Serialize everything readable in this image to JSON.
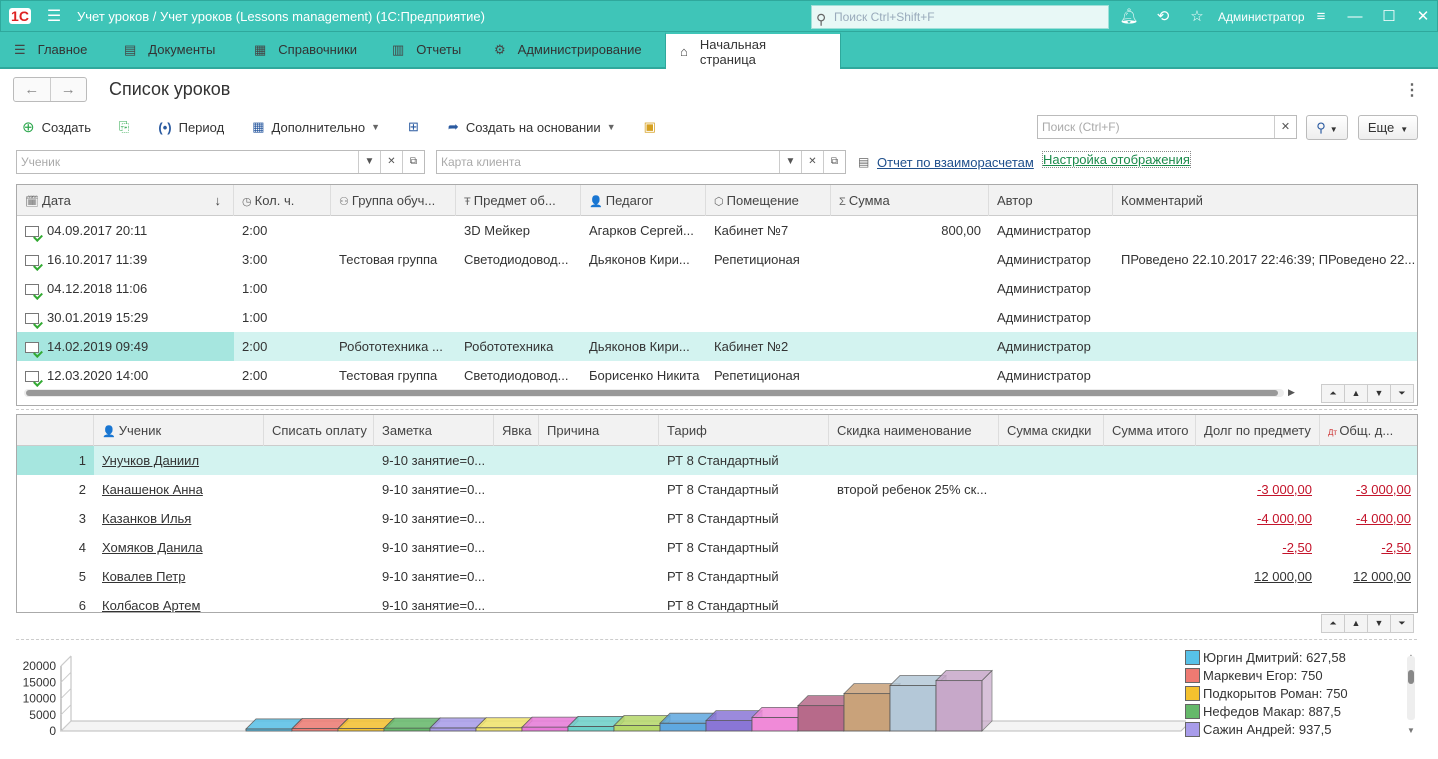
{
  "window": {
    "title": "Учет уроков / Учет уроков (Lessons management)  (1С:Предприятие)",
    "search_placeholder": "Поиск Ctrl+Shift+F",
    "user": "Администратор"
  },
  "sections": [
    {
      "label": "Главное",
      "icon": "menu-icon"
    },
    {
      "label": "Документы",
      "icon": "documents-icon"
    },
    {
      "label": "Справочники",
      "icon": "catalogs-icon"
    },
    {
      "label": "Отчеты",
      "icon": "reports-icon"
    },
    {
      "label": "Администрирование",
      "icon": "admin-gear-icon"
    },
    {
      "label": "Начальная страница",
      "icon": "home-icon"
    }
  ],
  "page": {
    "title": "Список уроков"
  },
  "toolbar": {
    "create": "Создать",
    "period": "Период",
    "additional": "Дополнительно",
    "create_based": "Создать на основании",
    "search_placeholder": "Поиск (Ctrl+F)",
    "more": "Еще"
  },
  "filters": {
    "student_placeholder": "Ученик",
    "client_card_placeholder": "Карта клиента",
    "report_link": "Отчет по взаиморасчетам",
    "display_settings_link": "Настройка отображения"
  },
  "lessons": {
    "columns": [
      "Дата",
      "Кол. ч.",
      "Группа обуч...",
      "Предмет об...",
      "Педагог",
      "Помещение",
      "Сумма",
      "Автор",
      "Комментарий"
    ],
    "rows": [
      [
        "04.09.2017 20:11",
        "2:00",
        "",
        "3D Мейкер",
        "Агарков Сергей...",
        "Кабинет №7",
        "800,00",
        "Администратор",
        ""
      ],
      [
        "16.10.2017 11:39",
        "3:00",
        "Тестовая группа",
        "Светодиодовод...",
        "Дьяконов Кири...",
        "Репетиционая",
        "",
        "Администратор",
        "ПРоведено 22.10.2017 22:46:39; ПРоведено 22..."
      ],
      [
        "04.12.2018 11:06",
        "1:00",
        "",
        "",
        "",
        "",
        "",
        "Администратор",
        ""
      ],
      [
        "30.01.2019 15:29",
        "1:00",
        "",
        "",
        "",
        "",
        "",
        "Администратор",
        ""
      ],
      [
        "14.02.2019 09:49",
        "2:00",
        "Робототехника ...",
        "Робототехника",
        "Дьяконов Кири...",
        "Кабинет №2",
        "",
        "Администратор",
        ""
      ],
      [
        "12.03.2020 14:00",
        "2:00",
        "Тестовая группа",
        "Светодиодовод...",
        "Борисенко Никита",
        "Репетиционая",
        "",
        "Администратор",
        ""
      ]
    ],
    "selected_index": 4
  },
  "students": {
    "columns": [
      "",
      "Ученик",
      "Списать оплату",
      "Заметка",
      "Явка",
      "Причина",
      "Тариф",
      "Скидка наименование",
      "Сумма скидки",
      "Сумма итого",
      "Долг по предмету",
      "Общ. д..."
    ],
    "rows": [
      [
        "1",
        "Унучков Даниил",
        "",
        "9-10 занятие=0...",
        "",
        "",
        "РТ 8 Стандартный",
        "",
        "",
        "",
        "",
        ""
      ],
      [
        "2",
        "Канашенок Анна",
        "",
        "9-10 занятие=0...",
        "",
        "",
        "РТ 8 Стандартный",
        "второй ребенок 25% ск...",
        "",
        "",
        "-3 000,00",
        "-3 000,00"
      ],
      [
        "3",
        "Казанков Илья",
        "",
        "9-10 занятие=0...",
        "",
        "",
        "РТ 8 Стандартный",
        "",
        "",
        "",
        "-4 000,00",
        "-4 000,00"
      ],
      [
        "4",
        "Хомяков Данила",
        "",
        "9-10 занятие=0...",
        "",
        "",
        "РТ 8 Стандартный",
        "",
        "",
        "",
        "-2,50",
        "-2,50"
      ],
      [
        "5",
        "Ковалев Петр",
        "",
        "9-10 занятие=0...",
        "",
        "",
        "РТ 8 Стандартный",
        "",
        "",
        "",
        "12 000,00",
        "12 000,00"
      ],
      [
        "6",
        "Колбасов Артем",
        "",
        "9-10 занятие=0...",
        "",
        "",
        "РТ 8 Стандартный",
        "",
        "",
        "",
        "",
        ""
      ]
    ],
    "selected_index": 0
  },
  "chart_data": {
    "type": "bar",
    "y_ticks": [
      "20000",
      "15000",
      "10000",
      "5000",
      "0"
    ],
    "ylim": [
      0,
      20000
    ],
    "values": [
      627.58,
      750,
      750,
      887.5,
      937.5,
      1000,
      1200,
      1400,
      1700,
      2400,
      3200,
      4200,
      7800,
      11500,
      14000,
      15500
    ],
    "colors": [
      "#57c1e8",
      "#ee7a72",
      "#f4c12e",
      "#65b96a",
      "#a89cea",
      "#f1e46a",
      "#e87ad8",
      "#6cd1c9",
      "#b6d86a",
      "#5fa8e0",
      "#8a76d6",
      "#f08ad8",
      "#b76a8a",
      "#c9a27a",
      "#b4c8d8",
      "#c7a8c9"
    ],
    "legend": [
      {
        "name": "Юргин Дмитрий: 627,58",
        "color": "#57c1e8"
      },
      {
        "name": "Маркевич Егор: 750",
        "color": "#ee7a72"
      },
      {
        "name": "Подкорытов Роман: 750",
        "color": "#f4c12e"
      },
      {
        "name": "Нефедов Макар: 887,5",
        "color": "#65b96a"
      },
      {
        "name": "Сажин Андрей: 937,5",
        "color": "#a89cea"
      }
    ]
  }
}
